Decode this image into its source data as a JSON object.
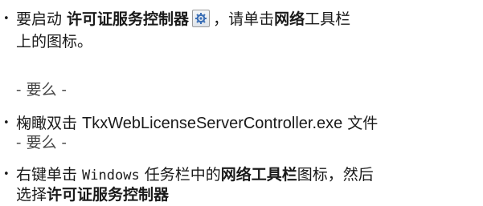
{
  "bullet_char": "•",
  "items": [
    {
      "seg1": " 要启动 ",
      "bold1": "许可证服务控制器",
      "icon": "license-server-controller-icon",
      "seg2": "，请单击",
      "bold2": "网络",
      "seg3": "工具栏",
      "line2": "上的图标。"
    },
    {
      "text": "- 要么 -"
    },
    {
      "seg1": " 椈瞰双击 ",
      "filename": "TkxWebLicenseServerController.exe",
      "seg2": " 文件",
      "after": "- 要么 -"
    },
    {
      "seg1": " 右键单击 ",
      "windows": "Windows",
      "seg2": " 任务栏中的",
      "bold1": "网络工具栏",
      "seg3": "图标，然后",
      "line2a": "选择",
      "bold2": "许可证服务控制器"
    }
  ],
  "colors": {
    "icon_blue": "#3b6fb6",
    "text": "#1a1a1a"
  }
}
